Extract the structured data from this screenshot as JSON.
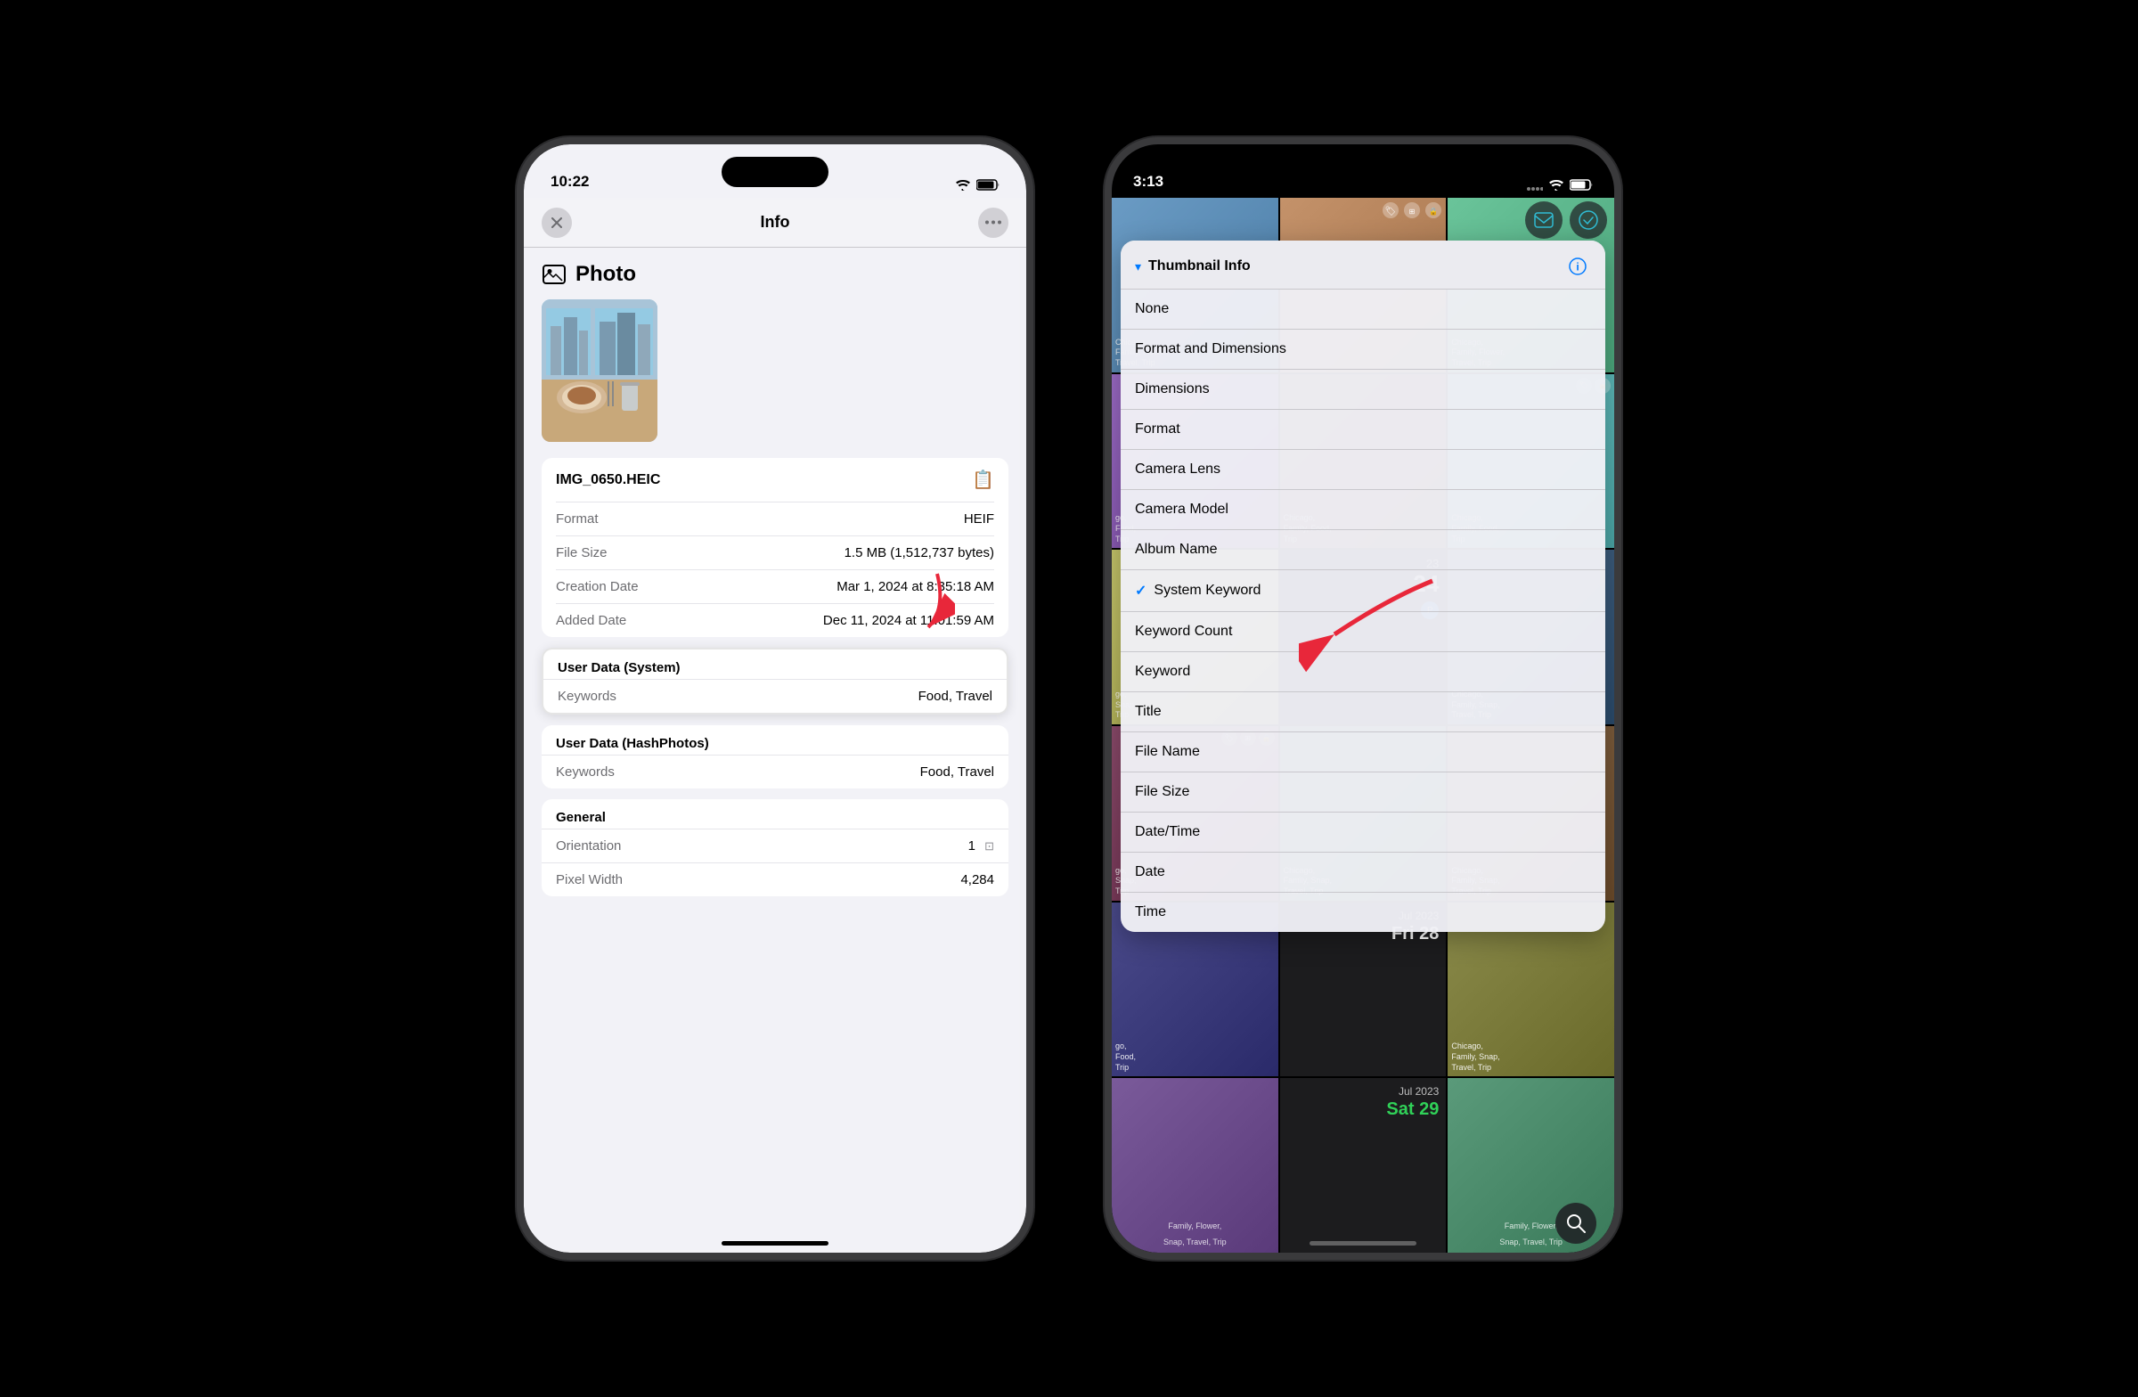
{
  "phone1": {
    "status": {
      "time": "10:22",
      "icons": [
        "wifi",
        "battery"
      ]
    },
    "nav": {
      "close": "✕",
      "title": "Info",
      "more": "···"
    },
    "photo_section": {
      "title": "Photo"
    },
    "file_info": {
      "filename": "IMG_0650.HEIC",
      "rows": [
        {
          "label": "Format",
          "value": "HEIF"
        },
        {
          "label": "File Size",
          "value": "1.5 MB (1,512,737 bytes)"
        },
        {
          "label": "Creation Date",
          "value": "Mar 1, 2024 at 8:35:18 AM"
        },
        {
          "label": "Added Date",
          "value": "Dec 11, 2024 at 11:01:59 AM"
        }
      ]
    },
    "user_data_system": {
      "title": "User Data (System)",
      "keywords_label": "Keywords",
      "keywords_value": "Food, Travel"
    },
    "user_data_hashphotos": {
      "title": "User Data (HashPhotos)",
      "keywords_label": "Keywords",
      "keywords_value": "Food, Travel"
    },
    "general": {
      "title": "General",
      "orientation_label": "Orientation",
      "orientation_value": "1",
      "pixel_width_label": "Pixel Width",
      "pixel_width_value": "4,284"
    }
  },
  "phone2": {
    "status": {
      "time": "3:13",
      "icons": [
        "signal",
        "wifi",
        "battery"
      ]
    },
    "dropdown": {
      "header_title": "Thumbnail Info",
      "items": [
        {
          "label": "None",
          "checked": false
        },
        {
          "label": "Format and Dimensions",
          "checked": false
        },
        {
          "label": "Dimensions",
          "checked": false
        },
        {
          "label": "Format",
          "checked": false
        },
        {
          "label": "Camera Lens",
          "checked": false
        },
        {
          "label": "Camera Model",
          "checked": false
        },
        {
          "label": "Album Name",
          "checked": false
        },
        {
          "label": "System Keyword",
          "checked": true
        },
        {
          "label": "Keyword Count",
          "checked": false
        },
        {
          "label": "Keyword",
          "checked": false
        },
        {
          "label": "Title",
          "checked": false
        },
        {
          "label": "File Name",
          "checked": false
        },
        {
          "label": "File Size",
          "checked": false
        },
        {
          "label": "Date/Time",
          "checked": false
        },
        {
          "label": "Date",
          "checked": false
        },
        {
          "label": "Time",
          "checked": false
        }
      ]
    },
    "grid_labels": [
      "Chicago, Family, Flower, Travel, Trip",
      "Chicago, Family, Food, Trip",
      "Chicago, Family, Snap, Travel, Trip",
      "Chicago, Family, Snap, Travel, Trip",
      "Chicago, Family, Snap, Travel, Trip",
      "Chicago, Family, Snap, Travel, Trip"
    ],
    "dates": [
      {
        "num": "24",
        "month": ""
      },
      {
        "num": "Fri 28",
        "month": "Jul 2023"
      },
      {
        "num": "Sat 29",
        "month": "Jul 2023"
      }
    ]
  }
}
